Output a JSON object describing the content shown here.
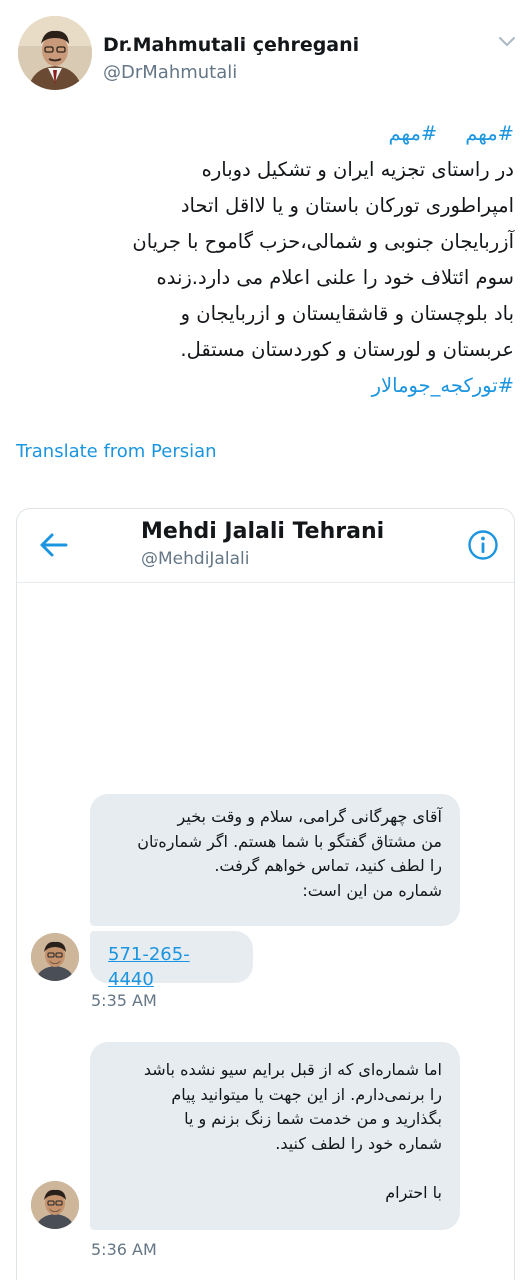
{
  "tweet": {
    "author_name": "Dr.Mahmutali çehregani",
    "author_handle": "@DrMahmutali",
    "hashtags_top": [
      "#مهم",
      "#مهم"
    ],
    "body_lines": [
      "در راستای تجزیه ایران و تشکیل دوباره",
      "امپراطوری تورکان باستان و یا لااقل اتحاد",
      "آزربایجان جنوبی و شمالی،حزب گاموح با جریان",
      "سوم ائتلاف خود را علنی اعلام می دارد.زنده",
      "باد بلوچستان و قاشقایستان و ازربایجان و",
      "عربستان و لورستان و کوردستان مستقل."
    ],
    "hashtag_bottom": "#تورکجه_جومالار",
    "translate_label": "Translate from Persian"
  },
  "dm": {
    "name": "Mehdi Jalali Tehrani",
    "handle": "@MehdiJalali",
    "icons": {
      "back": "back-arrow-icon",
      "info": "info-icon",
      "more": "chevron-down-icon"
    },
    "accent_color": "#1b95e0",
    "messages": [
      {
        "lines": [
          "آقای چهرگانی گرامی، سلام و وقت بخیر",
          "من مشتاق گفتگو با شما هستم.  اگر شماره‌تان",
          "را لطف کنید، تماس خواهم گرفت.",
          "شماره من این است:"
        ],
        "link": "571-265-4440",
        "time": "5:35 AM"
      },
      {
        "lines": [
          "اما شماره‌ای که از قبل برایم سیو نشده باشد",
          "را برنمی‌دارم. از این جهت یا میتوانید پیام",
          "بگذارید و من خدمت شما زنگ بزنم و یا",
          "شماره خود را لطف کنید."
        ],
        "closing": "با احترام",
        "time": "5:36 AM"
      }
    ]
  }
}
